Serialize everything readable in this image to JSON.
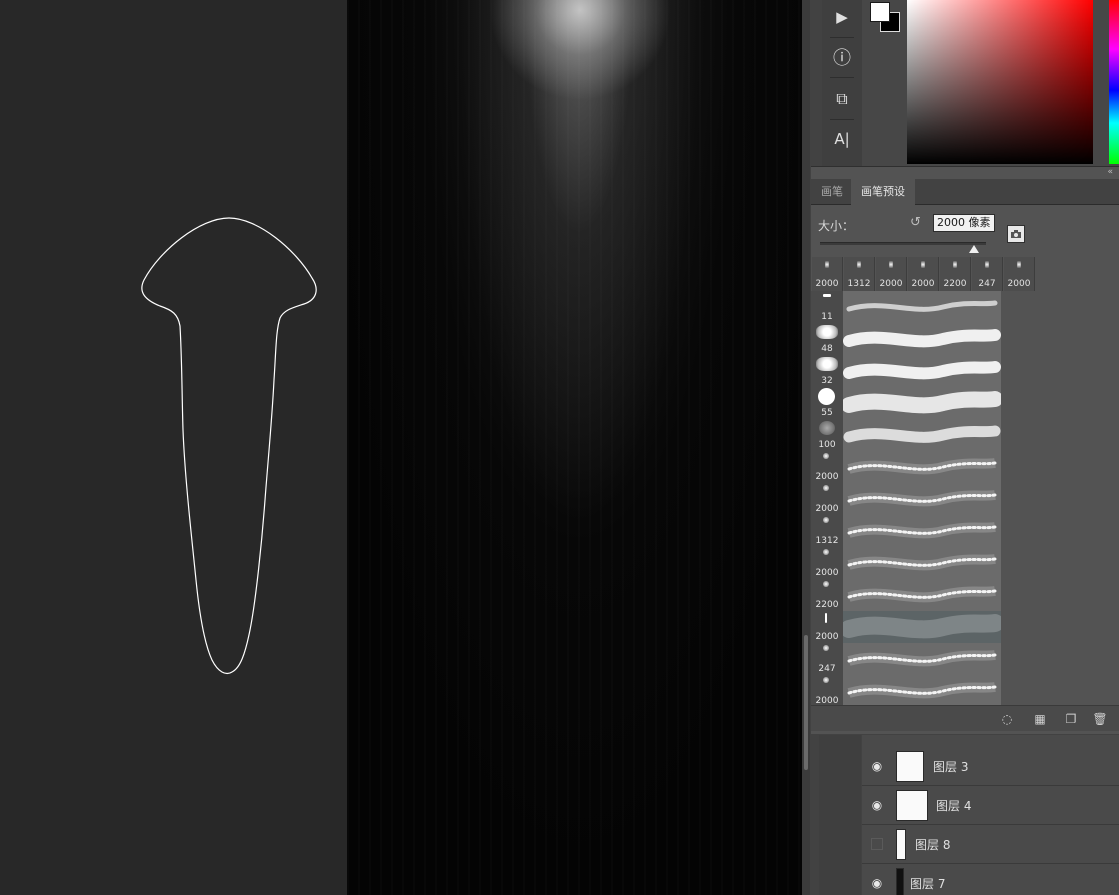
{
  "tools": [
    {
      "icon": "play-icon",
      "glyph": "▶"
    },
    {
      "icon": "info-icon",
      "glyph": "ⓘ"
    },
    {
      "icon": "transform-icon",
      "glyph": "⧉"
    },
    {
      "icon": "character-icon",
      "glyph": "A|"
    }
  ],
  "brush_panel": {
    "collapse_glyph": "«",
    "tabs": [
      {
        "label": "画笔",
        "active": false
      },
      {
        "label": "画笔预设",
        "active": true
      }
    ],
    "size_label": "大小：",
    "size_value": "2000 像素",
    "recent_brushes": [
      "2000",
      "1312",
      "2000",
      "2000",
      "2200",
      "247",
      "2000"
    ],
    "presets": [
      {
        "size": "11",
        "style": "pencil",
        "selected": false
      },
      {
        "size": "48",
        "style": "splatter",
        "selected": false
      },
      {
        "size": "32",
        "style": "splatter",
        "selected": false
      },
      {
        "size": "55",
        "style": "hard-round",
        "selected": false
      },
      {
        "size": "100",
        "style": "chalk",
        "selected": false
      },
      {
        "size": "2000",
        "style": "light",
        "selected": false
      },
      {
        "size": "2000",
        "style": "light",
        "selected": false
      },
      {
        "size": "1312",
        "style": "light",
        "selected": false
      },
      {
        "size": "2000",
        "style": "light",
        "selected": false
      },
      {
        "size": "2200",
        "style": "light",
        "selected": false
      },
      {
        "size": "2000",
        "style": "beam",
        "selected": true
      },
      {
        "size": "247",
        "style": "light",
        "selected": false
      },
      {
        "size": "2000",
        "style": "light",
        "selected": false
      }
    ],
    "footer_icons": [
      "toggle-visibility-icon",
      "grid-icon",
      "new-preset-icon",
      "trash-icon"
    ]
  },
  "layers": [
    {
      "name": "图层 3",
      "visible": true
    },
    {
      "name": "图层 4",
      "visible": true
    },
    {
      "name": "图层 8",
      "visible": false
    },
    {
      "name": "图层 7",
      "visible": true
    }
  ],
  "colors": {
    "foreground": "#ffffff",
    "background": "#000000",
    "selection_accent": "#2f8fd6"
  }
}
